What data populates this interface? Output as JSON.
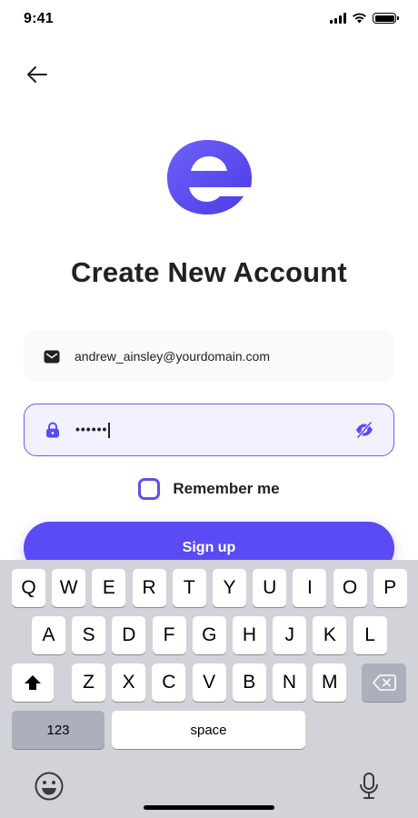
{
  "status_bar": {
    "time": "9:41"
  },
  "title": "Create New Account",
  "form": {
    "email_value": "andrew_ainsley@yourdomain.com",
    "password_masked": "••••••",
    "remember_label": "Remember me",
    "signup_label": "Sign up"
  },
  "colors": {
    "accent": "#5b4bf4",
    "field_bg": "#fafafa",
    "active_field_bg": "#f2f1fe"
  },
  "keyboard": {
    "row1": [
      "Q",
      "W",
      "E",
      "R",
      "T",
      "Y",
      "U",
      "I",
      "O",
      "P"
    ],
    "row2": [
      "A",
      "S",
      "D",
      "F",
      "G",
      "H",
      "J",
      "K",
      "L"
    ],
    "row3": [
      "Z",
      "X",
      "C",
      "V",
      "B",
      "N",
      "M"
    ],
    "numbers_key": "123",
    "space_key": "space"
  }
}
